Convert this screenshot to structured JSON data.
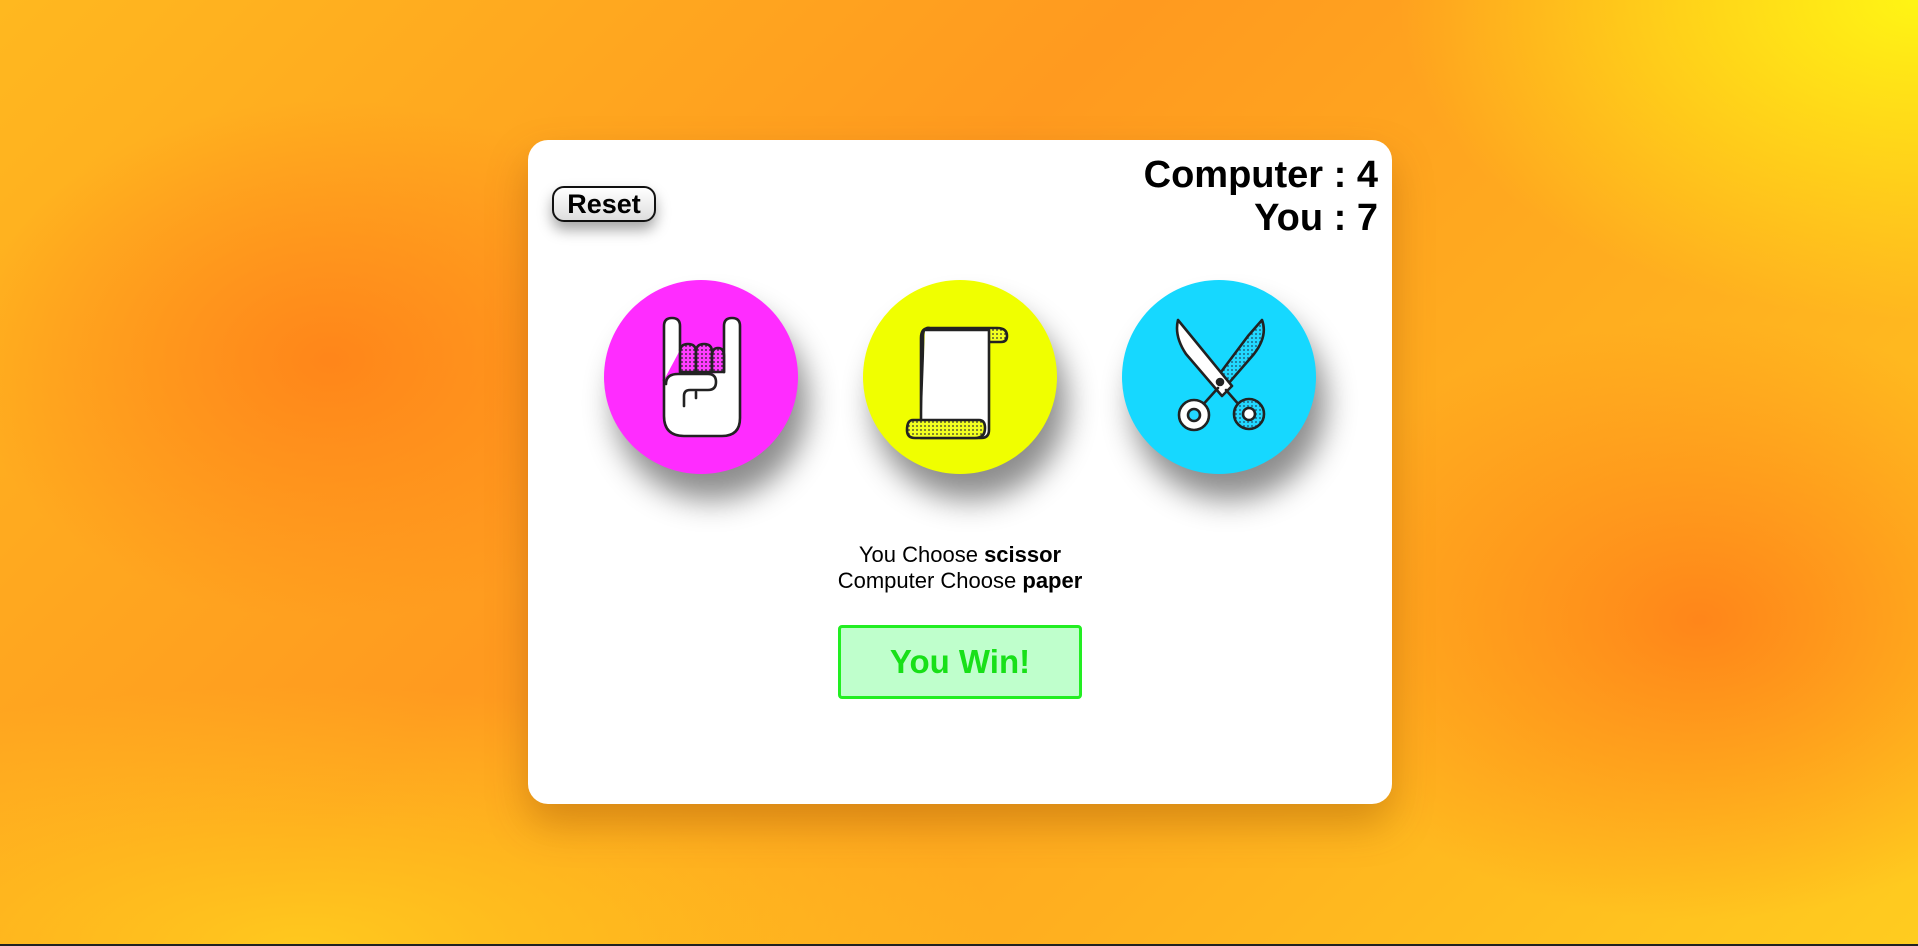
{
  "game": {
    "reset_label": "Reset",
    "score": {
      "computer_label": "Computer",
      "computer_value": "4",
      "you_label": "You",
      "you_value": "7",
      "separator": " : "
    },
    "choices": [
      {
        "id": "rock",
        "icon": "rock-hand-icon",
        "color": "#ff2cff"
      },
      {
        "id": "paper",
        "icon": "paper-scroll-icon",
        "color": "#f0ff00"
      },
      {
        "id": "scissor",
        "icon": "scissors-icon",
        "color": "#16d8ff"
      }
    ],
    "result": {
      "you_prefix": "You Choose",
      "you_choice": "scissor",
      "computer_prefix": "Computer Choose",
      "computer_choice": "paper"
    },
    "outcome": {
      "text": "You Win!",
      "text_color": "#18e018",
      "border_color": "#22ee22",
      "background_color": "#bfffcc"
    }
  }
}
